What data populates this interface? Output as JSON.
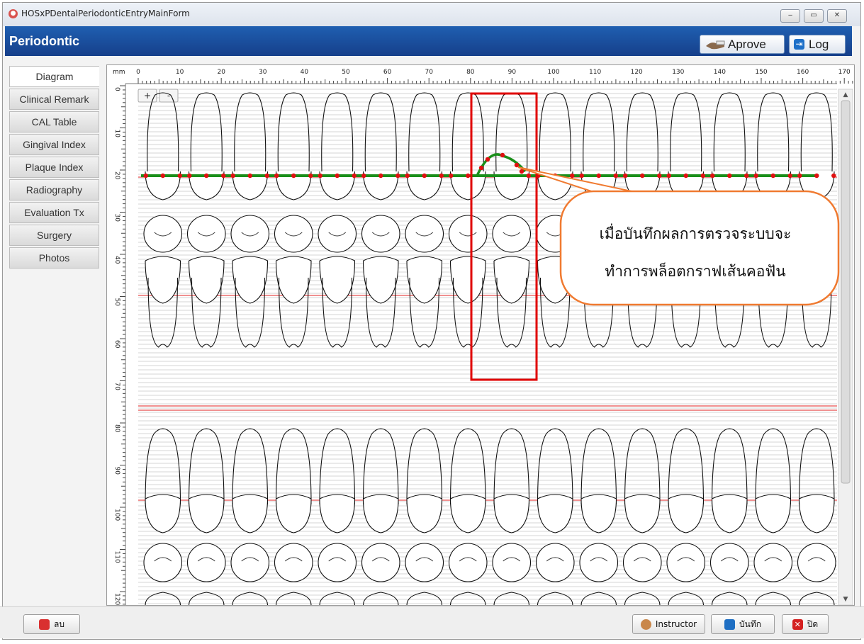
{
  "window": {
    "title": "HOSxPDentalPeriodonticEntryMainForm",
    "min": "‒",
    "max": "▭",
    "close": "✕"
  },
  "header": {
    "title": "Periodontic",
    "approve_label": "Aprove",
    "log_label": "Log"
  },
  "tabs": [
    "Diagram",
    "Clinical Remark",
    "CAL Table",
    "Gingival Index",
    "Plaque Index",
    "Radiography",
    "Evaluation Tx",
    "Surgery",
    "Photos"
  ],
  "ruler": {
    "unit": "mm",
    "top_ticks": [
      "0",
      "10",
      "20",
      "30",
      "40",
      "50",
      "60",
      "70",
      "80",
      "90",
      "100",
      "110",
      "120",
      "130",
      "140",
      "150",
      "160",
      "170"
    ],
    "left_ticks": [
      "0",
      "10",
      "20",
      "30",
      "40",
      "50",
      "60",
      "70",
      "80",
      "90",
      "100",
      "110",
      "120"
    ]
  },
  "zoom": {
    "plus": "+",
    "minus": "-"
  },
  "callout": {
    "line1": "เมื่อบันทึกผลการตรวจระบบจะ",
    "line2": "ทำการพล็อตกราฟเส้นคอฟัน"
  },
  "footer": {
    "delete_label": "ลบ",
    "instructor_label": "Instructor",
    "save_label": "บันทึก",
    "close_label": "ปิด"
  },
  "colors": {
    "header": "#1c53a4",
    "gum_line": "#1a8f1a",
    "points": "#e01010",
    "ref_line": "#e02020",
    "highlight": "#e00000",
    "callout_border": "#f07a30"
  }
}
